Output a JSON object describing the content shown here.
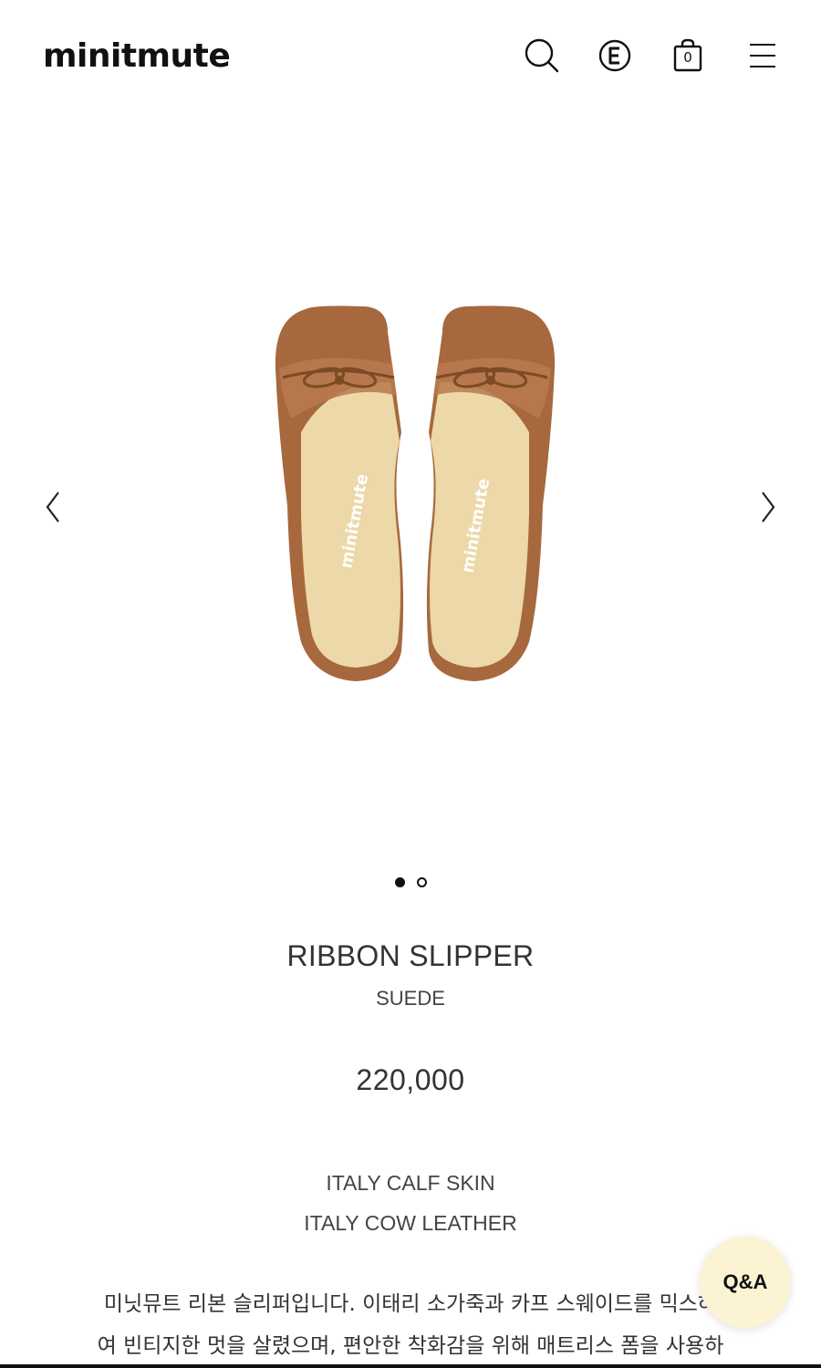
{
  "header": {
    "logo": "minitmute",
    "cart_count": "0"
  },
  "gallery": {
    "shoe_logo_left": "minitmute",
    "shoe_logo_right": "minitmute",
    "slide_count": 2,
    "active_slide": 1
  },
  "product": {
    "name": "RIBBON SLIPPER",
    "variant": "SUEDE",
    "price": "220,000",
    "materials": [
      "ITALY CALF SKIN",
      "ITALY COW LEATHER"
    ],
    "description_lines": [
      "미닛뮤트 리본 슬리퍼입니다. 이태리 소가죽과 카프 스웨이드를 믹스하",
      "여 빈티지한 멋을 살렸으며, 편안한 착화감을 위해 매트리스 폼을 사용하"
    ]
  },
  "qa_button": {
    "label": "Q&A"
  },
  "colors": {
    "accent_qa": "#fbf3d2",
    "shoe_leather": "#a7683d",
    "shoe_insole": "#ecd8a8"
  }
}
